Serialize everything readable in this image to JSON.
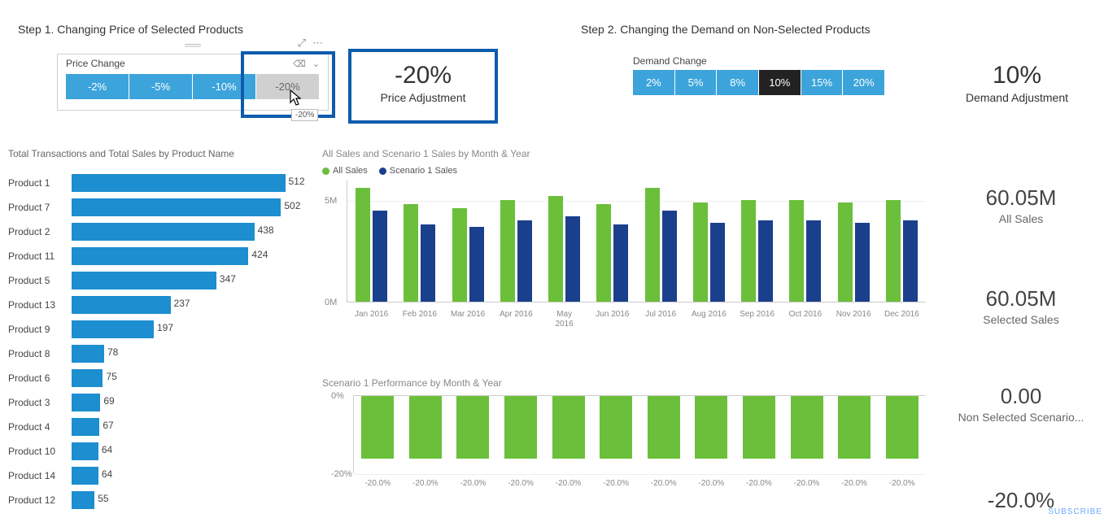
{
  "step1": {
    "title": "Step 1. Changing Price of Selected Products",
    "slicer_label": "Price Change",
    "chips": [
      "-2%",
      "-5%",
      "-10%",
      "-20%"
    ],
    "selected_index": 3,
    "tooltip": "-20%"
  },
  "step2": {
    "title": "Step 2. Changing the Demand on Non-Selected Products",
    "slicer_label": "Demand Change",
    "chips": [
      "2%",
      "5%",
      "8%",
      "10%",
      "15%",
      "20%"
    ],
    "selected_index": 3
  },
  "price_adj": {
    "value": "-20%",
    "label": "Price Adjustment"
  },
  "demand_adj": {
    "value": "10%",
    "label": "Demand Adjustment"
  },
  "cards": {
    "all_sales": {
      "value": "60.05M",
      "label": "All Sales"
    },
    "selected_sales": {
      "value": "60.05M",
      "label": "Selected Sales"
    },
    "non_selected": {
      "value": "0.00",
      "label": "Non Selected Scenario..."
    },
    "pct": {
      "value": "-20.0%",
      "label": ""
    }
  },
  "hbar": {
    "title": "Total Transactions and Total Sales by Product Name"
  },
  "colchart": {
    "title": "All Sales and Scenario 1 Sales by Month & Year",
    "legend": [
      "All Sales",
      "Scenario 1 Sales"
    ],
    "yticks": [
      "5M",
      "0M"
    ]
  },
  "negchart": {
    "title": "Scenario 1 Performance by Month & Year",
    "yticks": [
      "0%",
      "-20%"
    ]
  },
  "colors": {
    "blue": "#1d8ecf",
    "lightblue": "#3ca4db",
    "green": "#6bbf3a",
    "navy": "#1a3f8c",
    "highlight": "#0b5cad"
  },
  "chart_data": [
    {
      "type": "bar",
      "orientation": "horizontal",
      "title": "Total Transactions and Total Sales by Product Name",
      "ylabel": "Product Name",
      "xlabel": "",
      "categories": [
        "Product 1",
        "Product 7",
        "Product 2",
        "Product 11",
        "Product 5",
        "Product 13",
        "Product 9",
        "Product 8",
        "Product 6",
        "Product 3",
        "Product 4",
        "Product 10",
        "Product 14",
        "Product 12"
      ],
      "values": [
        512,
        502,
        438,
        424,
        347,
        237,
        197,
        78,
        75,
        69,
        67,
        64,
        64,
        55
      ],
      "xlim": [
        0,
        550
      ]
    },
    {
      "type": "bar",
      "title": "All Sales and Scenario 1 Sales by Month & Year",
      "xlabel": "Month & Year",
      "ylabel": "",
      "categories": [
        "Jan 2016",
        "Feb 2016",
        "Mar 2016",
        "Apr 2016",
        "May 2016",
        "Jun 2016",
        "Jul 2016",
        "Aug 2016",
        "Sep 2016",
        "Oct 2016",
        "Nov 2016",
        "Dec 2016"
      ],
      "series": [
        {
          "name": "All Sales",
          "values": [
            5.6,
            4.8,
            4.6,
            5.0,
            5.2,
            4.8,
            5.6,
            4.9,
            5.0,
            5.0,
            4.9,
            5.0
          ]
        },
        {
          "name": "Scenario 1 Sales",
          "values": [
            4.5,
            3.8,
            3.7,
            4.0,
            4.2,
            3.8,
            4.5,
            3.9,
            4.0,
            4.0,
            3.9,
            4.0
          ]
        }
      ],
      "ylim": [
        0,
        6
      ],
      "y_unit": "M"
    },
    {
      "type": "bar",
      "title": "Scenario 1 Performance by Month & Year",
      "xlabel": "Month & Year",
      "ylabel": "",
      "categories": [
        "Jan 2016",
        "Feb 2016",
        "Mar 2016",
        "Apr 2016",
        "May 2016",
        "Jun 2016",
        "Jul 2016",
        "Aug 2016",
        "Sep 2016",
        "Oct 2016",
        "Nov 2016",
        "Dec 2016"
      ],
      "values": [
        -20.0,
        -20.0,
        -20.0,
        -20.0,
        -20.0,
        -20.0,
        -20.0,
        -20.0,
        -20.0,
        -20.0,
        -20.0,
        -20.0
      ],
      "data_labels": [
        "-20.0%",
        "-20.0%",
        "-20.0%",
        "-20.0%",
        "-20.0%",
        "-20.0%",
        "-20.0%",
        "-20.0%",
        "-20.0%",
        "-20.0%",
        "-20.0%",
        "-20.0%"
      ],
      "ylim": [
        -25,
        0
      ],
      "y_unit": "%"
    }
  ]
}
